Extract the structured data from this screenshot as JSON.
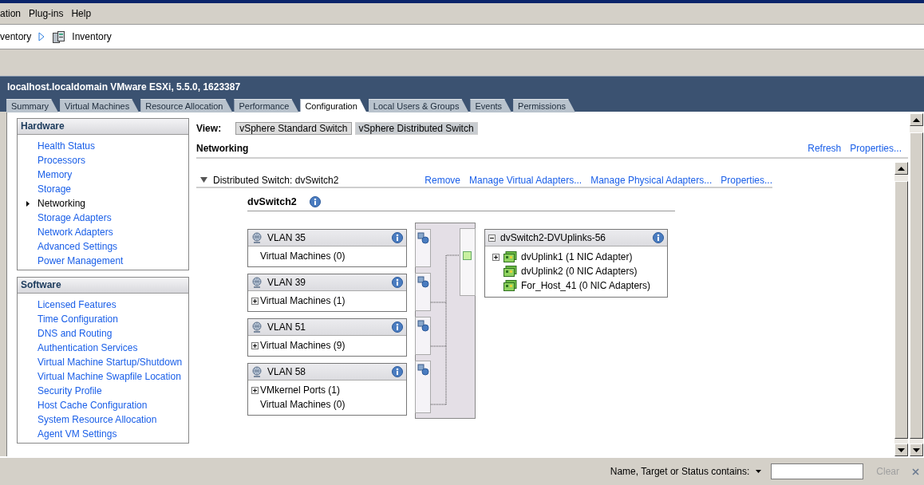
{
  "menu": [
    {
      "label": "ation"
    },
    {
      "label": "Plug-ins"
    },
    {
      "label": "Help"
    }
  ],
  "breadcrumb": [
    "ventory",
    "Inventory"
  ],
  "host": {
    "title": "localhost.localdomain VMware ESXi, 5.5.0, 1623387",
    "tabs": [
      {
        "label": "Summary",
        "selected": false
      },
      {
        "label": "Virtual Machines",
        "selected": false
      },
      {
        "label": "Resource Allocation",
        "selected": false
      },
      {
        "label": "Performance",
        "selected": false
      },
      {
        "label": "Configuration",
        "selected": true
      },
      {
        "label": "Local Users & Groups",
        "selected": false
      },
      {
        "label": "Events",
        "selected": false
      },
      {
        "label": "Permissions",
        "selected": false
      }
    ]
  },
  "sidebar": [
    {
      "title": "Hardware",
      "items": [
        {
          "label": "Health Status",
          "selected": false
        },
        {
          "label": "Processors",
          "selected": false
        },
        {
          "label": "Memory",
          "selected": false
        },
        {
          "label": "Storage",
          "selected": false
        },
        {
          "label": "Networking",
          "selected": true
        },
        {
          "label": "Storage Adapters",
          "selected": false
        },
        {
          "label": "Network Adapters",
          "selected": false
        },
        {
          "label": "Advanced Settings",
          "selected": false
        },
        {
          "label": "Power Management",
          "selected": false
        }
      ]
    },
    {
      "title": "Software",
      "items": [
        {
          "label": "Licensed Features",
          "selected": false
        },
        {
          "label": "Time Configuration",
          "selected": false
        },
        {
          "label": "DNS and Routing",
          "selected": false
        },
        {
          "label": "Authentication Services",
          "selected": false
        },
        {
          "label": "Virtual Machine Startup/Shutdown",
          "selected": false
        },
        {
          "label": "Virtual Machine Swapfile Location",
          "selected": false
        },
        {
          "label": "Security Profile",
          "selected": false
        },
        {
          "label": "Host Cache Configuration",
          "selected": false
        },
        {
          "label": "System Resource Allocation",
          "selected": false
        },
        {
          "label": "Agent VM Settings",
          "selected": false
        }
      ]
    }
  ],
  "view": {
    "label": "View:",
    "buttons": [
      {
        "label": "vSphere Standard Switch",
        "selected": false
      },
      {
        "label": "vSphere Distributed Switch",
        "selected": true
      }
    ]
  },
  "networking": {
    "title": "Networking",
    "actions": [
      "Refresh",
      "Properties..."
    ]
  },
  "switch": {
    "header": "Distributed Switch: dvSwitch2",
    "expanded": true,
    "actions": [
      "Remove",
      "Manage Virtual Adapters...",
      "Manage Physical Adapters...",
      "Properties..."
    ],
    "name": "dvSwitch2",
    "port_groups": [
      {
        "name": "VLAN 35",
        "entries": [
          {
            "label": "Virtual Machines (0)",
            "expandable": false
          }
        ]
      },
      {
        "name": "VLAN 39",
        "entries": [
          {
            "label": "Virtual Machines (1)",
            "expandable": true
          }
        ]
      },
      {
        "name": "VLAN 51",
        "entries": [
          {
            "label": "Virtual Machines (9)",
            "expandable": true
          }
        ]
      },
      {
        "name": "VLAN 58",
        "entries": [
          {
            "label": "VMkernel Ports (1)",
            "expandable": true
          },
          {
            "label": "Virtual Machines (0)",
            "expandable": false
          }
        ]
      }
    ],
    "uplinks": {
      "name": "dvSwitch2-DVUplinks-56",
      "expanded": true,
      "items": [
        {
          "label": "dvUplink1 (1 NIC Adapter)",
          "expandable": true
        },
        {
          "label": "dvUplink2 (0 NIC Adapters)",
          "expandable": false
        },
        {
          "label": "For_Host_41 (0 NIC Adapters)",
          "expandable": false
        }
      ]
    }
  },
  "filter": {
    "label": "Name, Target or Status contains:",
    "clear": {
      "label": "Clear",
      "disabled": true
    }
  }
}
